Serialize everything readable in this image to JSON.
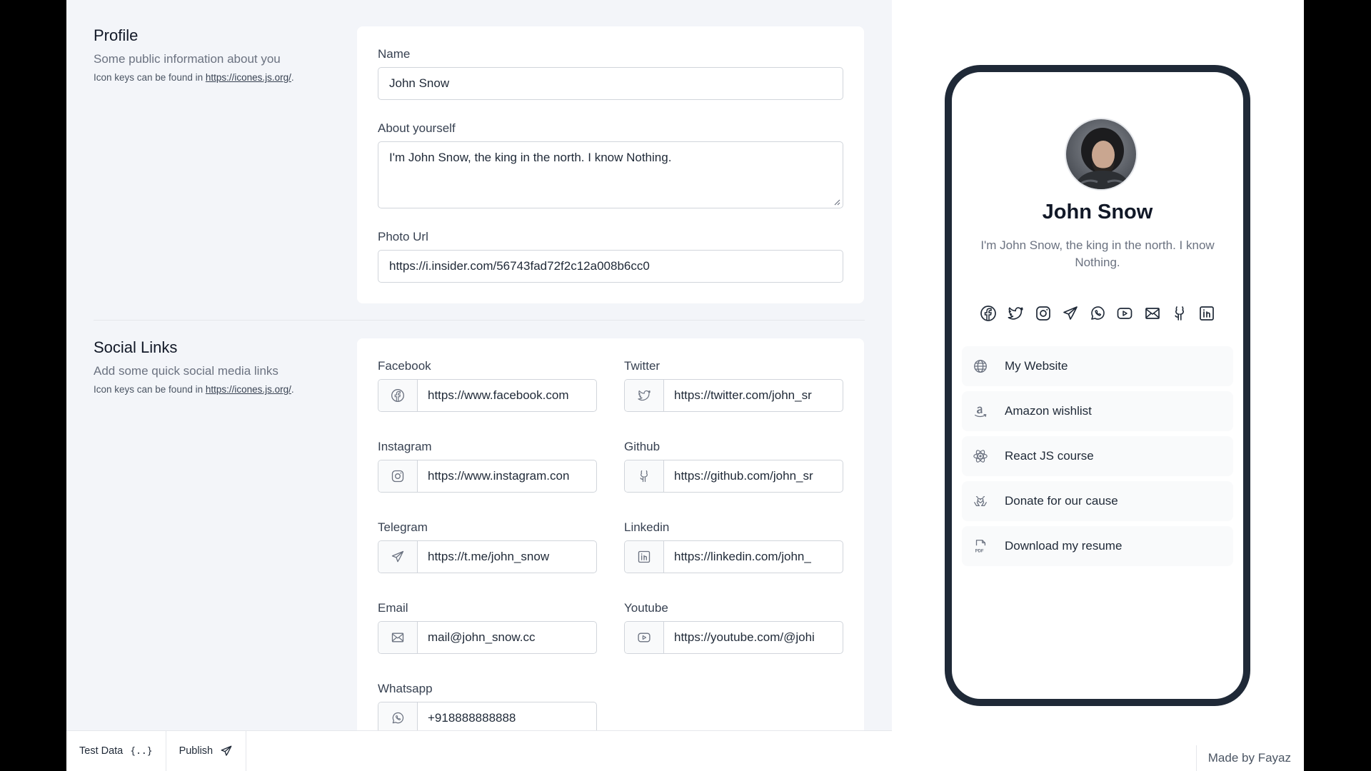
{
  "profile": {
    "title": "Profile",
    "description": "Some public information about you",
    "note_prefix": "Icon keys can be found in ",
    "note_link": "https://icones.js.org/",
    "note_suffix": ".",
    "name_label": "Name",
    "name_value": "John Snow",
    "about_label": "About yourself",
    "about_value": "I'm John Snow, the king in the north. I know Nothing.",
    "photo_label": "Photo Url",
    "photo_value": "https://i.insider.com/56743fad72f2c12a008b6cc0"
  },
  "social": {
    "title": "Social Links",
    "description": "Add some quick social media links",
    "note_prefix": "Icon keys can be found in ",
    "note_link": "https://icones.js.org/",
    "note_suffix": ".",
    "facebook": {
      "label": "Facebook",
      "value": "https://www.facebook.com",
      "icon": "facebook-icon"
    },
    "twitter": {
      "label": "Twitter",
      "value": "https://twitter.com/john_sr",
      "icon": "twitter-icon"
    },
    "instagram": {
      "label": "Instagram",
      "value": "https://www.instagram.con",
      "icon": "instagram-icon"
    },
    "github": {
      "label": "Github",
      "value": "https://github.com/john_sr",
      "icon": "github-icon"
    },
    "telegram": {
      "label": "Telegram",
      "value": "https://t.me/john_snow",
      "icon": "telegram-icon"
    },
    "linkedin": {
      "label": "Linkedin",
      "value": "https://linkedin.com/john_",
      "icon": "linkedin-icon"
    },
    "email": {
      "label": "Email",
      "value": "mail@john_snow.cc",
      "icon": "mail-icon"
    },
    "youtube": {
      "label": "Youtube",
      "value": "https://youtube.com/@johi",
      "icon": "youtube-icon"
    },
    "whatsapp": {
      "label": "Whatsapp",
      "value": "+918888888888",
      "icon": "whatsapp-icon"
    }
  },
  "bottom_bar": {
    "test_data": "Test Data",
    "test_data_icon": "{..}",
    "publish": "Publish"
  },
  "preview": {
    "name": "John Snow",
    "bio": "I'm John Snow, the king in the north. I know Nothing.",
    "social_icons": [
      "facebook-icon",
      "twitter-icon",
      "instagram-icon",
      "telegram-icon",
      "whatsapp-icon",
      "youtube-icon",
      "mail-icon",
      "github-icon",
      "linkedin-icon"
    ],
    "links": [
      {
        "label": "My Website",
        "icon": "globe-icon"
      },
      {
        "label": "Amazon wishlist",
        "icon": "amazon-icon"
      },
      {
        "label": "React JS course",
        "icon": "react-icon"
      },
      {
        "label": "Donate for our cause",
        "icon": "donate-icon"
      },
      {
        "label": "Download my resume",
        "icon": "pdf-icon"
      }
    ]
  },
  "credit": "Made by Fayaz",
  "colors": {
    "editor_bg": "#f3f5f9",
    "phone_border": "#1f2937",
    "text": "#1f2937",
    "muted": "#6b7280"
  }
}
